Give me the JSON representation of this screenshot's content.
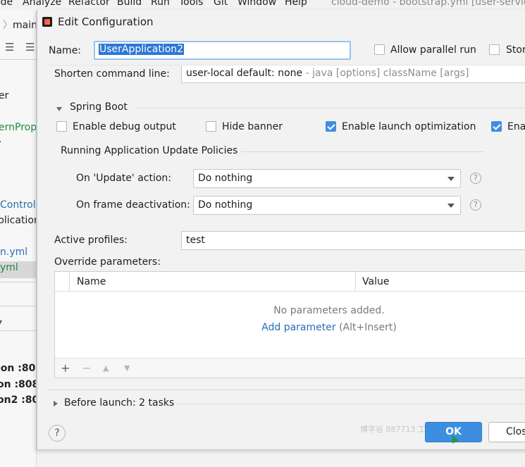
{
  "ide": {
    "menu": [
      "ode",
      "Analyze",
      "Refactor",
      "Build",
      "Run",
      "Tools",
      "Git",
      "Window",
      "Help"
    ],
    "title": "cloud-demo - bootstrap.yml [user-servic",
    "breadcrumb": "main",
    "tree_items": [
      {
        "text": "er",
        "color": "#222222"
      },
      {
        "text": "ernProp",
        "color": "#1f8a3a"
      },
      {
        "text": ".",
        "color": "#222222"
      },
      {
        "text": "Control",
        "color": "#2470b3"
      },
      {
        "text": "plication",
        "color": "#222222"
      },
      {
        "text": "n.yml",
        "color": "#2470b3"
      },
      {
        "text": "yml",
        "color": "#1f8a3a"
      },
      {
        "text": "ion :808",
        "color": "#222222"
      },
      {
        "text": "on :8081",
        "color": "#222222"
      },
      {
        "text": "on2 :808",
        "color": "#222222"
      }
    ]
  },
  "dialog": {
    "title": "Edit Configuration",
    "name_label": "Name:",
    "name_value": "UserApplication2",
    "allow_parallel_label": "Allow parallel run",
    "store_label": "Stor",
    "shorten_label": "Shorten command line:",
    "shorten_value": "user-local default: none",
    "shorten_hint": "- java [options] className [args]",
    "spring_boot": {
      "header": "Spring Boot",
      "options": [
        {
          "label": "Enable debug output",
          "checked": false
        },
        {
          "label": "Hide banner",
          "checked": false
        },
        {
          "label": "Enable launch optimization",
          "checked": true
        },
        {
          "label": "Enal",
          "checked": true
        }
      ]
    },
    "policies": {
      "header": "Running Application Update Policies",
      "update_label": "On 'Update' action:",
      "update_value": "Do nothing",
      "frame_label": "On frame deactivation:",
      "frame_value": "Do nothing"
    },
    "active_profiles_label": "Active profiles:",
    "active_profiles_value": "test",
    "override_label": "Override parameters:",
    "table": {
      "columns": [
        "Name",
        "Value"
      ],
      "empty_text": "No parameters added.",
      "add_link": "Add parameter",
      "add_hint": "(Alt+Insert)"
    },
    "toolbar": [
      "+",
      "−",
      "▲",
      "▼"
    ],
    "before_launch": "Before launch: 2 tasks",
    "help": "?",
    "ok": "OK",
    "close": "Clos",
    "watermark": "博字谷 887713 工"
  },
  "colors": {
    "accent": "#3d8ee0",
    "link": "#2470b3",
    "selection": "#2d78d3"
  }
}
